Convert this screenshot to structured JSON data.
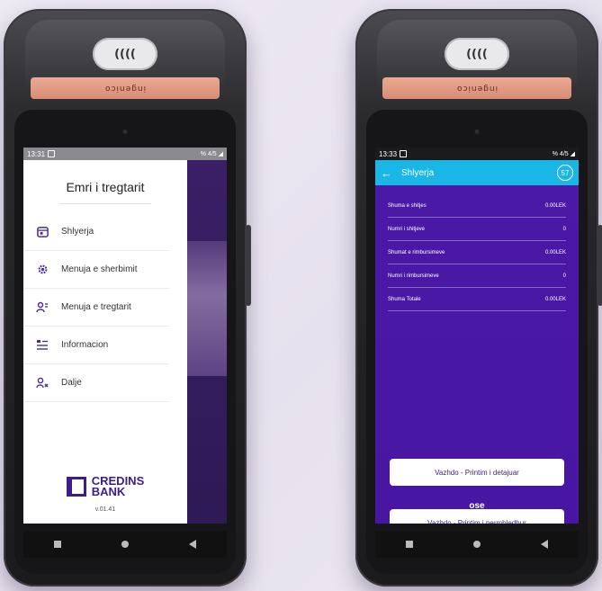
{
  "device_brand": "ingenico",
  "contactless_label": "((((",
  "left": {
    "status_time": "13:31",
    "status_right": "% 4/5 ◢",
    "drawer_title": "Emri i tregtarit",
    "menu": [
      {
        "label": "Shlyerja",
        "icon": "calendar-icon"
      },
      {
        "label": "Menuja e sherbimit",
        "icon": "gear-icon"
      },
      {
        "label": "Menuja e tregtarit",
        "icon": "merchant-icon"
      },
      {
        "label": "Informacion",
        "icon": "info-list-icon"
      },
      {
        "label": "Dalje",
        "icon": "logout-user-icon"
      }
    ],
    "logo_line1": "CREDINS",
    "logo_line2": "BANK",
    "version": "v.01.41"
  },
  "right": {
    "status_time": "13:33",
    "status_right": "% 4/5 ◢",
    "title": "Shlyerja",
    "badge": "57",
    "rows": [
      {
        "label": "Shuma e shitjes",
        "value": "0.00LEK"
      },
      {
        "label": "Numri i shitjeve",
        "value": "0"
      },
      {
        "label": "Shumat e rimbursimeve",
        "value": "0.00LEK"
      },
      {
        "label": "Numri i rimbursimeve",
        "value": "0"
      },
      {
        "label": "Shuma Totale",
        "value": "0.00LEK"
      }
    ],
    "btn_detailed": "Vazhdo - Printim i detajuar",
    "or_label": "ose",
    "btn_summary": "Vazhdo - Printim i permbledhur"
  },
  "colors": {
    "primary_purple": "#4a19a6",
    "appbar_blue": "#1ab6e6",
    "brand_strip": "#e3997f"
  }
}
